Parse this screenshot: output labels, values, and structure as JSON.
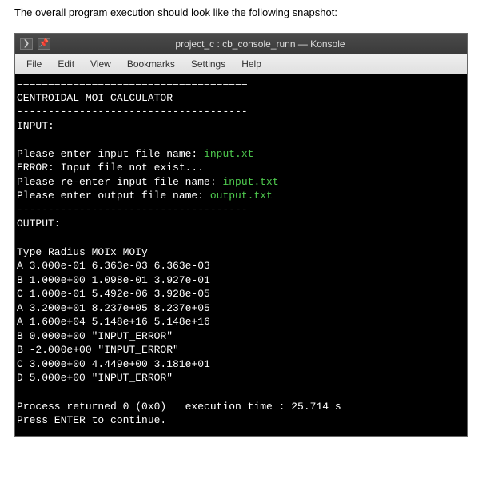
{
  "intro": "The overall program execution should look like the following snapshot:",
  "window": {
    "title": "project_c : cb_console_runn — Konsole",
    "icon1": "❯",
    "icon2": "📌"
  },
  "menu": {
    "file": "File",
    "edit": "Edit",
    "view": "View",
    "bookmarks": "Bookmarks",
    "settings": "Settings",
    "help": "Help"
  },
  "term": {
    "rule1": "=====================================",
    "title": "CENTROIDAL MOI CALCULATOR",
    "rule2": "-------------------------------------",
    "input_header": "INPUT:",
    "p1a": "Please enter input file name: ",
    "p1b": "input.xt",
    "err": "ERROR: Input file not exist...",
    "p2a": "Please re-enter input file name: ",
    "p2b": "input.txt",
    "p3a": "Please enter output file name: ",
    "p3b": "output.txt",
    "rule3": "-------------------------------------",
    "output_header": "OUTPUT:",
    "cols": "Type Radius MOIx MOIy",
    "r0": "A 3.000e-01 6.363e-03 6.363e-03",
    "r1": "B 1.000e+00 1.098e-01 3.927e-01",
    "r2": "C 1.000e-01 5.492e-06 3.928e-05",
    "r3": "A 3.200e+01 8.237e+05 8.237e+05",
    "r4": "A 1.600e+04 5.148e+16 5.148e+16",
    "r5": "B 0.000e+00 \"INPUT_ERROR\"",
    "r6": "B -2.000e+00 \"INPUT_ERROR\"",
    "r7": "C 3.000e+00 4.449e+00 3.181e+01",
    "r8": "D 5.000e+00 \"INPUT_ERROR\"",
    "proc": "Process returned 0 (0x0)   execution time : 25.714 s",
    "press": "Press ENTER to continue."
  }
}
